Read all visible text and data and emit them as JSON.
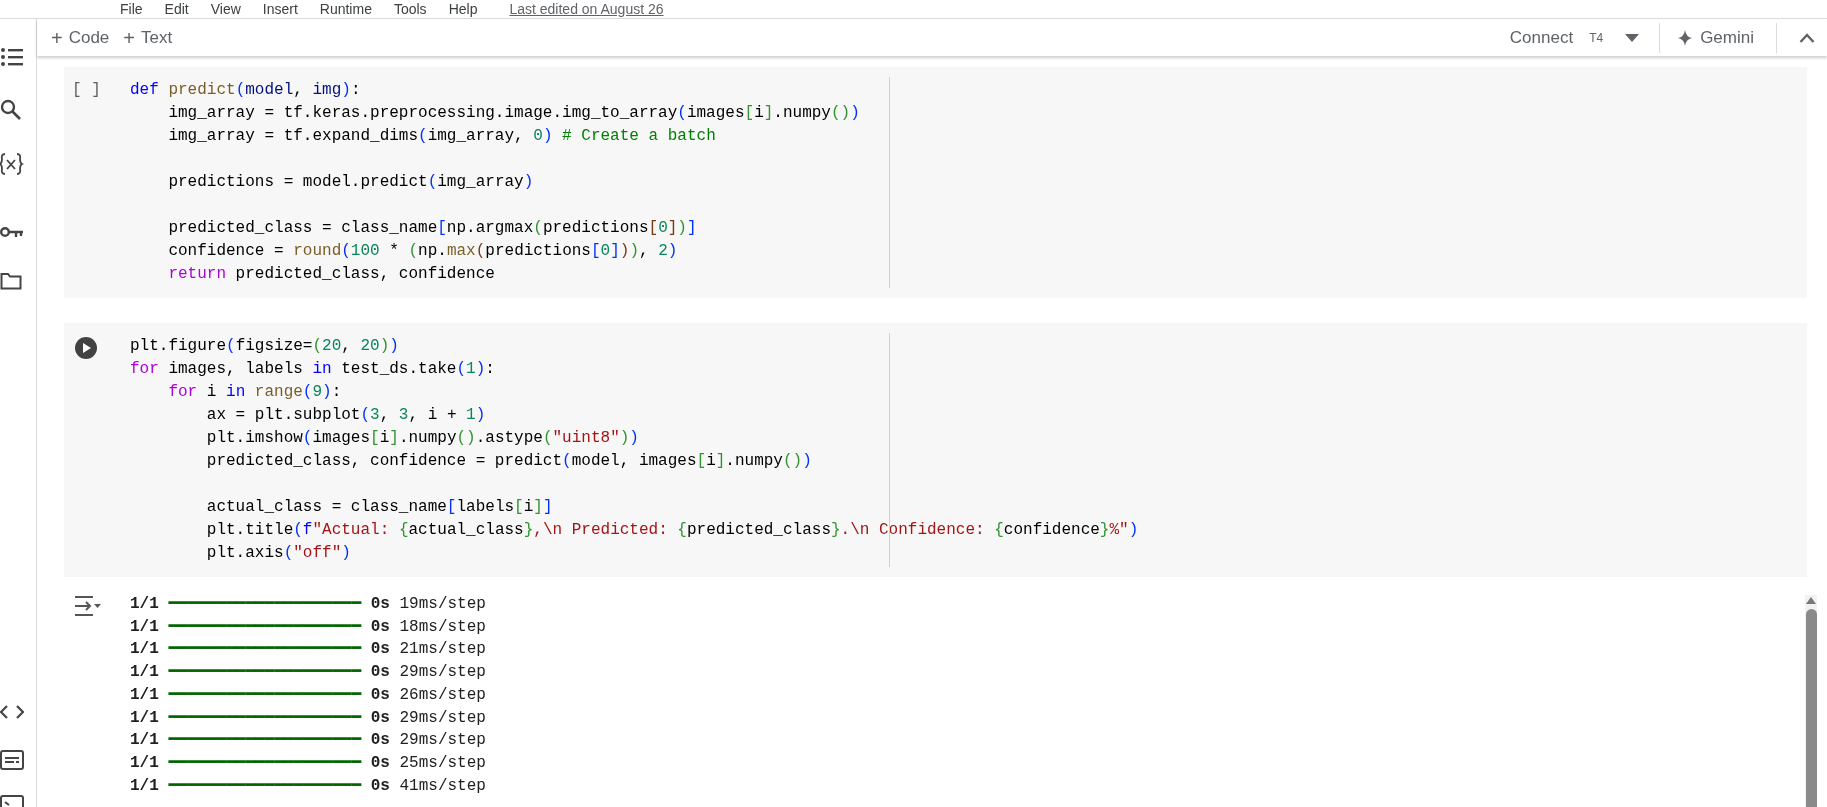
{
  "menu": {
    "items": [
      "File",
      "Edit",
      "View",
      "Insert",
      "Runtime",
      "Tools",
      "Help"
    ],
    "last_edited": "Last edited on August 26"
  },
  "toolbar": {
    "add_buttons": [
      {
        "icon": "+",
        "label": "Code"
      },
      {
        "icon": "+",
        "label": "Text"
      }
    ],
    "connect": "Connect",
    "runtime": "T4",
    "gemini": "Gemini"
  },
  "cells": [
    {
      "kind": "idle",
      "prompt": "[ ]",
      "lines": [
        {
          "tokens": [
            {
              "kind": "keyword",
              "text": "def "
            },
            {
              "kind": "function",
              "text": "predict"
            },
            {
              "kind": "bracket1",
              "text": "("
            },
            {
              "kind": "param",
              "text": "model"
            },
            {
              "kind": "plain",
              "text": ", "
            },
            {
              "kind": "param",
              "text": "img"
            },
            {
              "kind": "bracket1",
              "text": ")"
            },
            {
              "kind": "plain",
              "text": ":"
            }
          ]
        },
        {
          "tokens": [
            {
              "kind": "plain",
              "text": "    img_array = tf.keras.preprocessing.image.img_to_array"
            },
            {
              "kind": "bracket1",
              "text": "("
            },
            {
              "kind": "plain",
              "text": "images"
            },
            {
              "kind": "bracket2",
              "text": "["
            },
            {
              "kind": "plain",
              "text": "i"
            },
            {
              "kind": "bracket2",
              "text": "]"
            },
            {
              "kind": "plain",
              "text": ".numpy"
            },
            {
              "kind": "bracket2",
              "text": "()"
            },
            {
              "kind": "bracket1",
              "text": ")"
            }
          ]
        },
        {
          "tokens": [
            {
              "kind": "plain",
              "text": "    img_array = tf.expand_dims"
            },
            {
              "kind": "bracket1",
              "text": "("
            },
            {
              "kind": "plain",
              "text": "img_array, "
            },
            {
              "kind": "number",
              "text": "0"
            },
            {
              "kind": "bracket1",
              "text": ")"
            },
            {
              "kind": "comment",
              "text": " # Create a batch"
            }
          ]
        },
        {
          "gap_before": true,
          "tokens": [
            {
              "kind": "plain",
              "text": "    predictions = model.predict"
            },
            {
              "kind": "bracket1",
              "text": "("
            },
            {
              "kind": "plain",
              "text": "img_array"
            },
            {
              "kind": "bracket1",
              "text": ")"
            }
          ]
        },
        {
          "gap_before": true,
          "tokens": [
            {
              "kind": "plain",
              "text": "    predicted_class = class_name"
            },
            {
              "kind": "bracket1",
              "text": "["
            },
            {
              "kind": "plain",
              "text": "np.argmax"
            },
            {
              "kind": "bracket2",
              "text": "("
            },
            {
              "kind": "plain",
              "text": "predictions"
            },
            {
              "kind": "bracket3",
              "text": "["
            },
            {
              "kind": "number",
              "text": "0"
            },
            {
              "kind": "bracket3",
              "text": "]"
            },
            {
              "kind": "bracket2",
              "text": ")"
            },
            {
              "kind": "bracket1",
              "text": "]"
            }
          ]
        },
        {
          "tokens": [
            {
              "kind": "plain",
              "text": "    confidence = "
            },
            {
              "kind": "function",
              "text": "round"
            },
            {
              "kind": "bracket1",
              "text": "("
            },
            {
              "kind": "number",
              "text": "100"
            },
            {
              "kind": "plain",
              "text": " * "
            },
            {
              "kind": "bracket2",
              "text": "("
            },
            {
              "kind": "plain",
              "text": "np."
            },
            {
              "kind": "function",
              "text": "max"
            },
            {
              "kind": "bracket3",
              "text": "("
            },
            {
              "kind": "plain",
              "text": "predictions"
            },
            {
              "kind": "bracket1",
              "text": "["
            },
            {
              "kind": "number",
              "text": "0"
            },
            {
              "kind": "bracket1",
              "text": "]"
            },
            {
              "kind": "bracket3",
              "text": ")"
            },
            {
              "kind": "bracket2",
              "text": ")"
            },
            {
              "kind": "plain",
              "text": ", "
            },
            {
              "kind": "number",
              "text": "2"
            },
            {
              "kind": "bracket1",
              "text": ")"
            }
          ]
        },
        {
          "tokens": [
            {
              "kind": "control",
              "text": "    return"
            },
            {
              "kind": "plain",
              "text": " predicted_class, confidence"
            }
          ]
        }
      ]
    },
    {
      "kind": "run",
      "lines": [
        {
          "tokens": [
            {
              "kind": "plain",
              "text": "plt.figure"
            },
            {
              "kind": "bracket1",
              "text": "("
            },
            {
              "kind": "plain",
              "text": "figsize="
            },
            {
              "kind": "bracket2",
              "text": "("
            },
            {
              "kind": "number",
              "text": "20"
            },
            {
              "kind": "plain",
              "text": ", "
            },
            {
              "kind": "number",
              "text": "20"
            },
            {
              "kind": "bracket2",
              "text": ")"
            },
            {
              "kind": "bracket1",
              "text": ")"
            }
          ]
        },
        {
          "tokens": [
            {
              "kind": "control",
              "text": "for"
            },
            {
              "kind": "plain",
              "text": " images, labels "
            },
            {
              "kind": "keyword",
              "text": "in"
            },
            {
              "kind": "plain",
              "text": " test_ds.take"
            },
            {
              "kind": "bracket1",
              "text": "("
            },
            {
              "kind": "number",
              "text": "1"
            },
            {
              "kind": "bracket1",
              "text": ")"
            },
            {
              "kind": "plain",
              "text": ":"
            }
          ]
        },
        {
          "tokens": [
            {
              "kind": "control",
              "text": "    for"
            },
            {
              "kind": "plain",
              "text": " i "
            },
            {
              "kind": "keyword",
              "text": "in "
            },
            {
              "kind": "function",
              "text": "range"
            },
            {
              "kind": "bracket1",
              "text": "("
            },
            {
              "kind": "number",
              "text": "9"
            },
            {
              "kind": "bracket1",
              "text": ")"
            },
            {
              "kind": "plain",
              "text": ":"
            }
          ]
        },
        {
          "tokens": [
            {
              "kind": "plain",
              "text": "        ax = plt.subplot"
            },
            {
              "kind": "bracket1",
              "text": "("
            },
            {
              "kind": "number",
              "text": "3"
            },
            {
              "kind": "plain",
              "text": ", "
            },
            {
              "kind": "number",
              "text": "3"
            },
            {
              "kind": "plain",
              "text": ", i + "
            },
            {
              "kind": "number",
              "text": "1"
            },
            {
              "kind": "bracket1",
              "text": ")"
            }
          ]
        },
        {
          "tokens": [
            {
              "kind": "plain",
              "text": "        plt.imshow"
            },
            {
              "kind": "bracket1",
              "text": "("
            },
            {
              "kind": "plain",
              "text": "images"
            },
            {
              "kind": "bracket2",
              "text": "["
            },
            {
              "kind": "plain",
              "text": "i"
            },
            {
              "kind": "bracket2",
              "text": "]"
            },
            {
              "kind": "plain",
              "text": ".numpy"
            },
            {
              "kind": "bracket2",
              "text": "()"
            },
            {
              "kind": "plain",
              "text": ".astype"
            },
            {
              "kind": "bracket2",
              "text": "("
            },
            {
              "kind": "string",
              "text": "\"uint8\""
            },
            {
              "kind": "bracket2",
              "text": ")"
            },
            {
              "kind": "bracket1",
              "text": ")"
            }
          ]
        },
        {
          "tokens": [
            {
              "kind": "plain",
              "text": "        predicted_class, confidence = predict"
            },
            {
              "kind": "bracket1",
              "text": "("
            },
            {
              "kind": "plain",
              "text": "model, images"
            },
            {
              "kind": "bracket2",
              "text": "["
            },
            {
              "kind": "plain",
              "text": "i"
            },
            {
              "kind": "bracket2",
              "text": "]"
            },
            {
              "kind": "plain",
              "text": ".numpy"
            },
            {
              "kind": "bracket2",
              "text": "()"
            },
            {
              "kind": "bracket1",
              "text": ")"
            }
          ]
        },
        {
          "gap_before": true,
          "tokens": [
            {
              "kind": "plain",
              "text": "        actual_class = class_name"
            },
            {
              "kind": "bracket1",
              "text": "["
            },
            {
              "kind": "plain",
              "text": "labels"
            },
            {
              "kind": "bracket2",
              "text": "["
            },
            {
              "kind": "plain",
              "text": "i"
            },
            {
              "kind": "bracket2",
              "text": "]"
            },
            {
              "kind": "bracket1",
              "text": "]"
            }
          ]
        },
        {
          "tokens": [
            {
              "kind": "plain",
              "text": "        plt.title"
            },
            {
              "kind": "bracket1",
              "text": "("
            },
            {
              "kind": "keyword",
              "text": "f"
            },
            {
              "kind": "string",
              "text": "\"Actual: "
            },
            {
              "kind": "bracket2",
              "text": "{"
            },
            {
              "kind": "plain",
              "text": "actual_class"
            },
            {
              "kind": "bracket2",
              "text": "}"
            },
            {
              "kind": "string",
              "text": ",\\n Predicted: "
            },
            {
              "kind": "bracket2",
              "text": "{"
            },
            {
              "kind": "plain",
              "text": "predicted_class"
            },
            {
              "kind": "bracket2",
              "text": "}"
            },
            {
              "kind": "string",
              "text": ".\\n Confidence: "
            },
            {
              "kind": "bracket2",
              "text": "{"
            },
            {
              "kind": "plain",
              "text": "confidence"
            },
            {
              "kind": "bracket2",
              "text": "}"
            },
            {
              "kind": "string",
              "text": "%\""
            },
            {
              "kind": "bracket1",
              "text": ")"
            }
          ]
        },
        {
          "tokens": [
            {
              "kind": "plain",
              "text": "        plt.axis"
            },
            {
              "kind": "bracket1",
              "text": "("
            },
            {
              "kind": "string",
              "text": "\"off\""
            },
            {
              "kind": "bracket1",
              "text": ")"
            }
          ]
        }
      ]
    }
  ],
  "output": [
    {
      "step": "1/1",
      "bar": "━━━━━━━━━━━━━━━━━━━━",
      "time": "0s",
      "rate": "19ms/step"
    },
    {
      "step": "1/1",
      "bar": "━━━━━━━━━━━━━━━━━━━━",
      "time": "0s",
      "rate": "18ms/step"
    },
    {
      "step": "1/1",
      "bar": "━━━━━━━━━━━━━━━━━━━━",
      "time": "0s",
      "rate": "21ms/step"
    },
    {
      "step": "1/1",
      "bar": "━━━━━━━━━━━━━━━━━━━━",
      "time": "0s",
      "rate": "29ms/step"
    },
    {
      "step": "1/1",
      "bar": "━━━━━━━━━━━━━━━━━━━━",
      "time": "0s",
      "rate": "26ms/step"
    },
    {
      "step": "1/1",
      "bar": "━━━━━━━━━━━━━━━━━━━━",
      "time": "0s",
      "rate": "29ms/step"
    },
    {
      "step": "1/1",
      "bar": "━━━━━━━━━━━━━━━━━━━━",
      "time": "0s",
      "rate": "29ms/step"
    },
    {
      "step": "1/1",
      "bar": "━━━━━━━━━━━━━━━━━━━━",
      "time": "0s",
      "rate": "25ms/step"
    },
    {
      "step": "1/1",
      "bar": "━━━━━━━━━━━━━━━━━━━━",
      "time": "0s",
      "rate": "41ms/step"
    }
  ]
}
